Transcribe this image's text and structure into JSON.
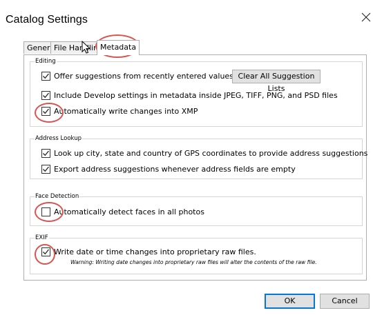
{
  "dialog": {
    "title": "Catalog Settings",
    "close_icon": "close-icon"
  },
  "tabs": [
    {
      "label": "General"
    },
    {
      "label": "File Handling"
    },
    {
      "label": "Metadata",
      "selected": true
    }
  ],
  "groups": {
    "editing": {
      "label": "Editing",
      "options": [
        {
          "label": "Offer suggestions from recently entered values",
          "checked": true
        },
        {
          "label": "Include Develop settings in metadata inside JPEG, TIFF, PNG, and PSD files",
          "checked": true
        },
        {
          "label": "Automatically write changes into XMP",
          "checked": true
        }
      ],
      "clear_button": "Clear All Suggestion Lists"
    },
    "address_lookup": {
      "label": "Address Lookup",
      "options": [
        {
          "label": "Look up city, state and country of GPS coordinates to provide address suggestions",
          "checked": true
        },
        {
          "label": "Export address suggestions whenever address fields are empty",
          "checked": true
        }
      ]
    },
    "face_detection": {
      "label": "Face Detection",
      "options": [
        {
          "label": "Automatically detect faces in all photos",
          "checked": false
        }
      ]
    },
    "exif": {
      "label": "EXIF",
      "options": [
        {
          "label": "Write date or time changes into proprietary raw files.",
          "checked": true
        }
      ],
      "warning": "Warning: Writing date changes into proprietary raw files will alter the contents of the raw file."
    }
  },
  "buttons": {
    "ok": "OK",
    "cancel": "Cancel"
  },
  "colors": {
    "highlight": "#d9534f",
    "default_button_border": "#0078d7"
  }
}
